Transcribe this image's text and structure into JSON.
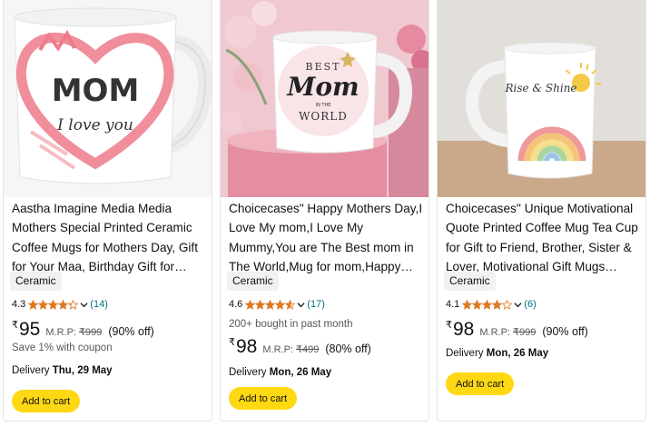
{
  "products": [
    {
      "title": "Aastha Imagine Media Media Mothers Special Printed Ceramic Coffee Mugs for Mothers Day, Gift for Your Maa, Birthday Gift for Mom, Anniversery…",
      "material": "Ceramic",
      "rating": "4.3",
      "rating_fraction": 0.86,
      "reviews": "(14)",
      "bought": "",
      "currency": "₹",
      "price": "95",
      "mrp_label": "M.R.P:",
      "mrp": "₹999",
      "discount": "(90% off)",
      "coupon": "Save 1% with coupon",
      "delivery_label": "Delivery",
      "delivery_date": "Thu, 29 May",
      "cart_label": "Add to cart",
      "mug_text": [
        "MOM",
        "I love you"
      ]
    },
    {
      "title": "Choicecases\" Happy Mothers Day,I Love My mom,I Love My Mummy,You are The Best mom in The World,Mug for mom,Happy Birthday mom Mu…",
      "material": "Ceramic",
      "rating": "4.6",
      "rating_fraction": 0.92,
      "reviews": "(17)",
      "bought": "200+ bought in past month",
      "currency": "₹",
      "price": "98",
      "mrp_label": "M.R.P:",
      "mrp": "₹499",
      "discount": "(80% off)",
      "coupon": "",
      "delivery_label": "Delivery",
      "delivery_date": "Mon, 26 May",
      "cart_label": "Add to cart",
      "mug_text": [
        "BEST",
        "Mom",
        "IN THE",
        "WORLD"
      ]
    },
    {
      "title": "Choicecases'' Unique Motivational Quote Printed Coffee Mug Tea Cup for Gift to Friend, Brother, Sister & Lover, Motivational Gift Mugs with…",
      "material": "Ceramic",
      "rating": "4.1",
      "rating_fraction": 0.82,
      "reviews": "(6)",
      "bought": "",
      "currency": "₹",
      "price": "98",
      "mrp_label": "M.R.P:",
      "mrp": "₹999",
      "discount": "(90% off)",
      "coupon": "",
      "delivery_label": "Delivery",
      "delivery_date": "Mon, 26 May",
      "cart_label": "Add to cart",
      "mug_text": [
        "Rise & Shine"
      ]
    }
  ],
  "colors": {
    "star": "#de7921",
    "cart_button": "#ffd814",
    "link": "#007185",
    "muted": "#565959"
  }
}
